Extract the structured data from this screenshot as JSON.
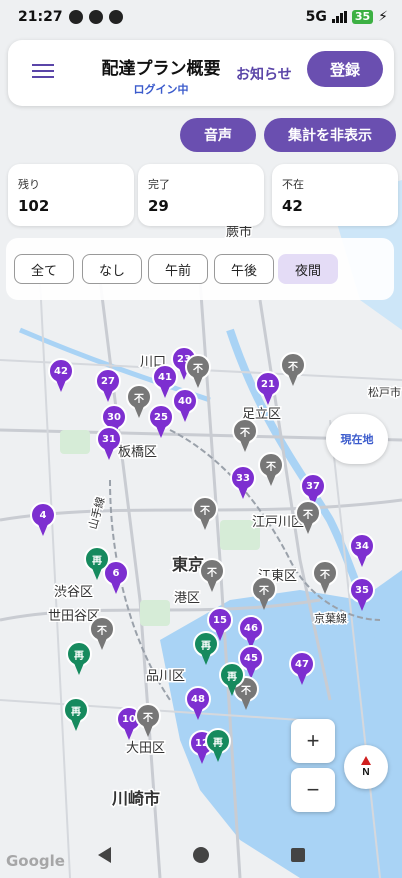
{
  "status_bar": {
    "time": "21:27",
    "network": "5G",
    "battery": "35"
  },
  "header": {
    "menu_icon": "hamburger-icon",
    "title": "配達プラン概要",
    "subtitle": "ログイン中",
    "notice_label": "お知らせ",
    "register_label": "登録"
  },
  "actions": {
    "voice_label": "音声",
    "hide_summary_label": "集計を非表示"
  },
  "stats": [
    {
      "label": "残り",
      "value": "102"
    },
    {
      "label": "完了",
      "value": "29"
    },
    {
      "label": "不在",
      "value": "42"
    }
  ],
  "filters": {
    "options": [
      "全て",
      "なし",
      "午前",
      "午後",
      "夜間"
    ],
    "selected": "夜間"
  },
  "map": {
    "place_labels": [
      "川口",
      "足立区",
      "板橋区",
      "江戸川区",
      "東京",
      "江東区",
      "渋谷区",
      "港区",
      "世田谷区",
      "品川区",
      "大田区",
      "川崎市",
      "蕨市",
      "松戸市",
      "京葉線",
      "山手線"
    ],
    "markers": {
      "pending": [
        "42",
        "27",
        "23",
        "41",
        "30",
        "25",
        "40",
        "21",
        "31",
        "33",
        "37",
        "4",
        "6",
        "34",
        "35",
        "15",
        "46",
        "45",
        "47",
        "48",
        "10",
        "12"
      ],
      "absent_label": "不",
      "redelivery_label": "再"
    },
    "colors": {
      "pending": "#7d2fd0",
      "absent": "#777777",
      "redelivery": "#168a5e",
      "accent": "#6a4fb0"
    },
    "current_location_label": "現在地",
    "zoom_in_label": "+",
    "zoom_out_label": "−",
    "compass_label": "N",
    "attribution": "Google"
  }
}
